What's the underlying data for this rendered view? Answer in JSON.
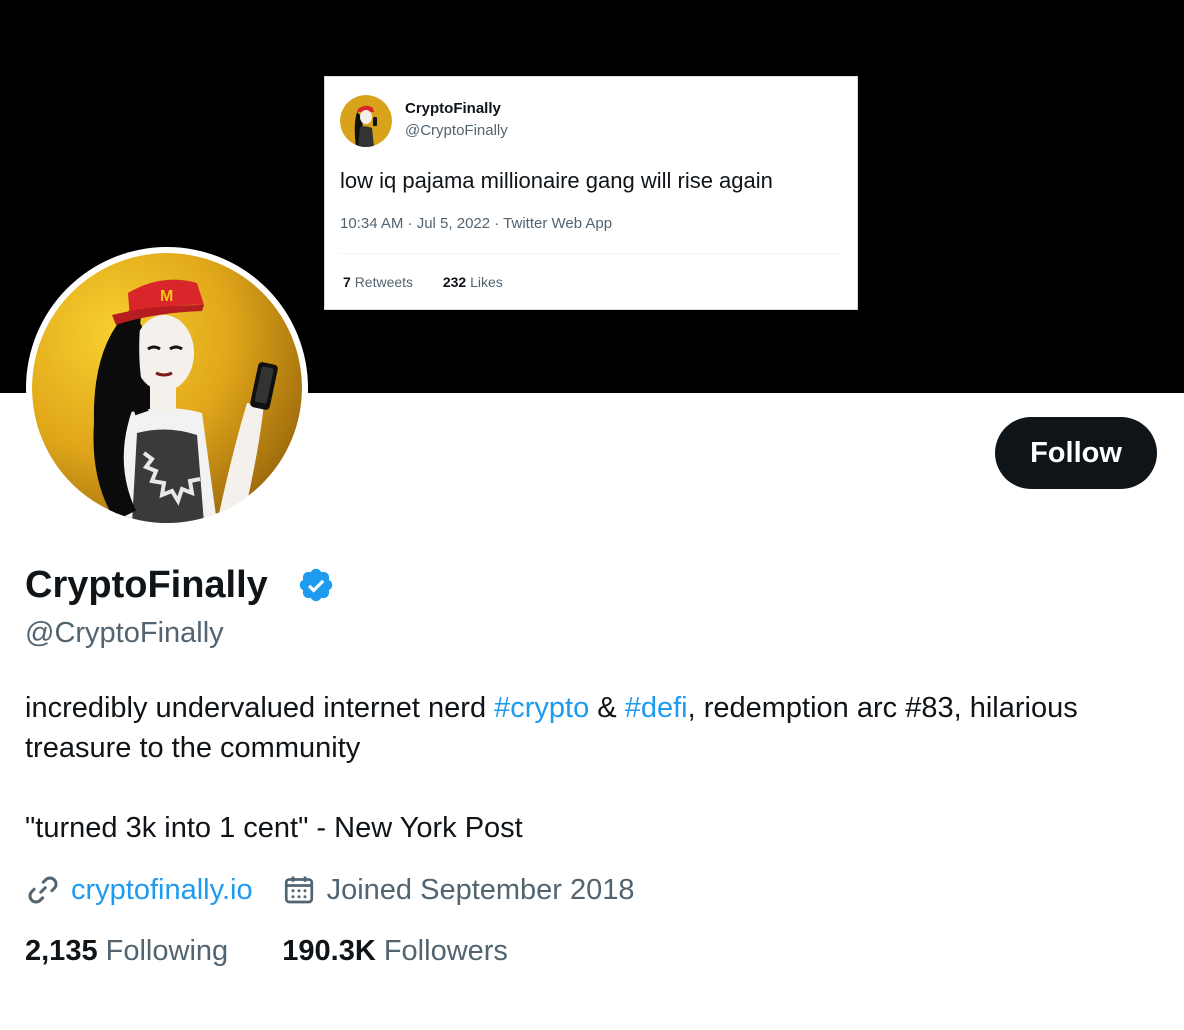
{
  "banner": {
    "tweet": {
      "name": "CryptoFinally",
      "handle": "@CryptoFinally",
      "text": "low iq pajama millionaire gang will rise again",
      "meta": "10:34 AM · Jul 5, 2022 · Twitter Web App",
      "retweets_count": "7",
      "retweets_label": "Retweets",
      "likes_count": "232",
      "likes_label": "Likes"
    }
  },
  "profile": {
    "display_name": "CryptoFinally",
    "verified_icon": "verified-badge-icon",
    "handle": "@CryptoFinally",
    "follow_label": "Follow",
    "bio": {
      "part1": "incredibly undervalued internet nerd ",
      "tag1": "#crypto",
      "part2": " & ",
      "tag2": "#defi",
      "part3": ", redemption arc #83, hilarious treasure to the community"
    },
    "quote": "\"turned 3k into 1 cent\" - New York Post",
    "website": "cryptofinally.io",
    "joined": "Joined September 2018",
    "following_count": "2,135",
    "following_label": "Following",
    "followers_count": "190.3K",
    "followers_label": "Followers"
  },
  "colors": {
    "accent": "#1d9bf0",
    "text": "#0f1419",
    "muted": "#536471",
    "avatar_bg": "#d9a21b"
  }
}
